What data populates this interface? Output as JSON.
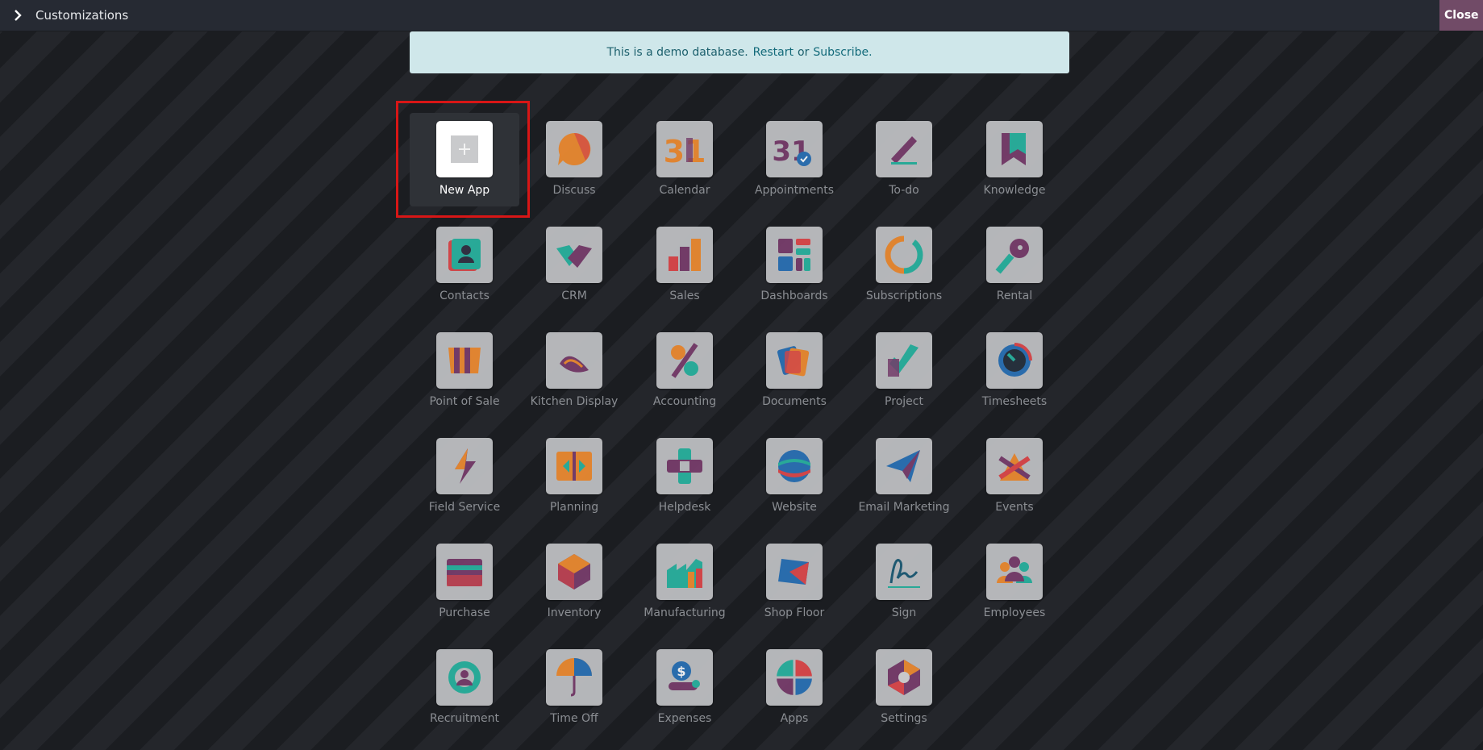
{
  "topbar": {
    "title": "Customizations",
    "toggle_icon": "chevron-right-icon",
    "close_label": "Close",
    "close_color": "#714b67"
  },
  "banner": {
    "text": "This is a demo database.",
    "restart_label": "Restart",
    "or_text": "or",
    "subscribe_label": "Subscribe."
  },
  "apps": [
    {
      "id": "new-app",
      "label": "New App",
      "icon": "plus-icon"
    },
    {
      "id": "discuss",
      "label": "Discuss",
      "icon": "discuss-icon"
    },
    {
      "id": "calendar",
      "label": "Calendar",
      "icon": "calendar-icon"
    },
    {
      "id": "appointments",
      "label": "Appointments",
      "icon": "appointments-icon"
    },
    {
      "id": "to-do",
      "label": "To-do",
      "icon": "to-do-icon"
    },
    {
      "id": "knowledge",
      "label": "Knowledge",
      "icon": "knowledge-icon"
    },
    {
      "id": "contacts",
      "label": "Contacts",
      "icon": "contacts-icon"
    },
    {
      "id": "crm",
      "label": "CRM",
      "icon": "crm-icon"
    },
    {
      "id": "sales",
      "label": "Sales",
      "icon": "sales-icon"
    },
    {
      "id": "dashboards",
      "label": "Dashboards",
      "icon": "dashboards-icon"
    },
    {
      "id": "subscriptions",
      "label": "Subscriptions",
      "icon": "subscriptions-icon"
    },
    {
      "id": "rental",
      "label": "Rental",
      "icon": "rental-icon"
    },
    {
      "id": "point-of-sale",
      "label": "Point of Sale",
      "icon": "point-of-sale-icon"
    },
    {
      "id": "kitchen-display",
      "label": "Kitchen Display",
      "icon": "kitchen-display-icon"
    },
    {
      "id": "accounting",
      "label": "Accounting",
      "icon": "accounting-icon"
    },
    {
      "id": "documents",
      "label": "Documents",
      "icon": "documents-icon"
    },
    {
      "id": "project",
      "label": "Project",
      "icon": "project-icon"
    },
    {
      "id": "timesheets",
      "label": "Timesheets",
      "icon": "timesheets-icon"
    },
    {
      "id": "field-service",
      "label": "Field Service",
      "icon": "field-service-icon"
    },
    {
      "id": "planning",
      "label": "Planning",
      "icon": "planning-icon"
    },
    {
      "id": "helpdesk",
      "label": "Helpdesk",
      "icon": "helpdesk-icon"
    },
    {
      "id": "website",
      "label": "Website",
      "icon": "website-icon"
    },
    {
      "id": "email-marketing",
      "label": "Email Marketing",
      "icon": "email-marketing-icon"
    },
    {
      "id": "events",
      "label": "Events",
      "icon": "events-icon"
    },
    {
      "id": "purchase",
      "label": "Purchase",
      "icon": "purchase-icon"
    },
    {
      "id": "inventory",
      "label": "Inventory",
      "icon": "inventory-icon"
    },
    {
      "id": "manufacturing",
      "label": "Manufacturing",
      "icon": "manufacturing-icon"
    },
    {
      "id": "shop-floor",
      "label": "Shop Floor",
      "icon": "shop-floor-icon"
    },
    {
      "id": "sign",
      "label": "Sign",
      "icon": "sign-icon"
    },
    {
      "id": "employees",
      "label": "Employees",
      "icon": "employees-icon"
    },
    {
      "id": "recruitment",
      "label": "Recruitment",
      "icon": "recruitment-icon"
    },
    {
      "id": "time-off",
      "label": "Time Off",
      "icon": "time-off-icon"
    },
    {
      "id": "expenses",
      "label": "Expenses",
      "icon": "expenses-icon"
    },
    {
      "id": "apps",
      "label": "Apps",
      "icon": "apps-icon"
    },
    {
      "id": "settings",
      "label": "Settings",
      "icon": "settings-icon"
    }
  ],
  "calendar_icon_text": "31",
  "appointments_icon_text": "31",
  "expenses_icon_text": "$",
  "colors": {
    "teal": "#2ab5a2",
    "purple": "#7a3e6e",
    "orange": "#f08d32",
    "red": "#e0494c",
    "blue": "#2b73b8",
    "yellow": "#f4b63a"
  }
}
